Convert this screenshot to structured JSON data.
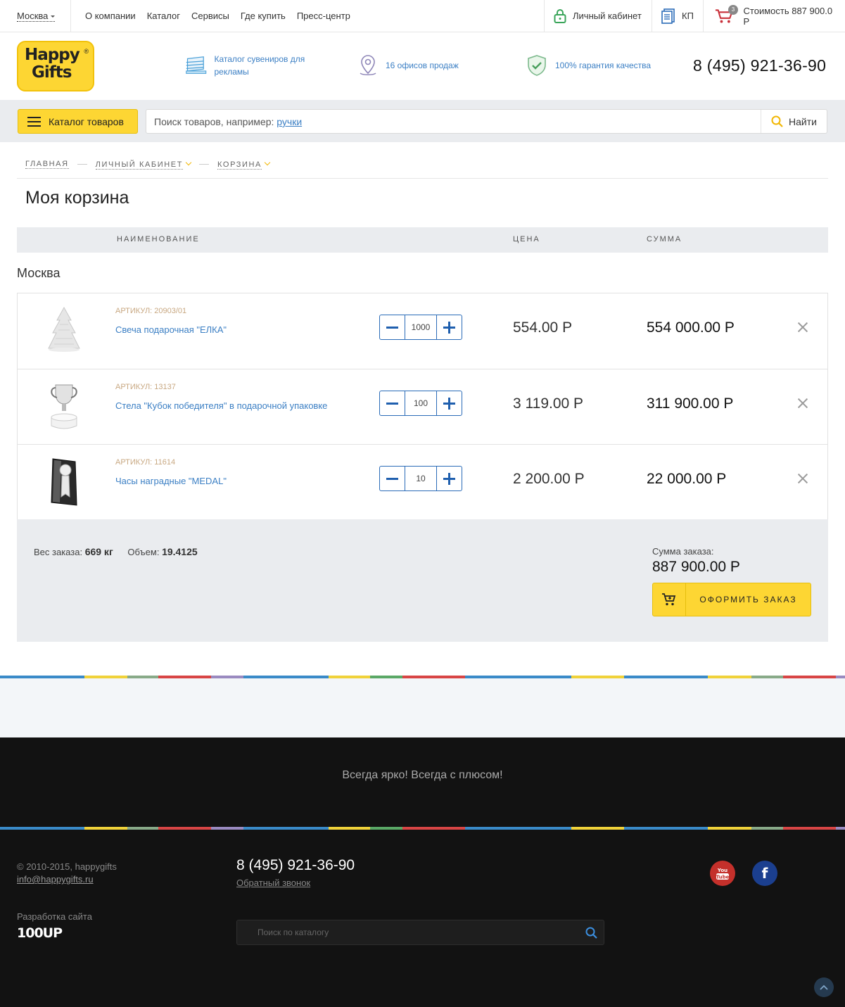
{
  "topbar": {
    "city": "Москва",
    "nav": [
      "О компании",
      "Каталог",
      "Сервисы",
      "Где купить",
      "Пресс-центр"
    ],
    "account": "Личный кабинет",
    "kp": "КП",
    "cart_count": "3",
    "cart_cost": "Стоимость 887 900.0 Р"
  },
  "header": {
    "logo_line1": "Happy",
    "logo_line2": "Gifts",
    "logo_reg": "®",
    "features": [
      {
        "text": "Каталог сувениров для рекламы",
        "icon": "catalog-book-icon"
      },
      {
        "text": "16 офисов продаж",
        "icon": "location-pin-icon"
      },
      {
        "text": "100% гарантия качества",
        "icon": "shield-check-icon"
      }
    ],
    "phone": "8 (495) 921-36-90"
  },
  "search": {
    "catalog_button": "Каталог товаров",
    "placeholder_prefix": "Поиск товаров, например:",
    "placeholder_example": "ручки",
    "button": "Найти"
  },
  "breadcrumbs": [
    "ГЛАВНАЯ",
    "ЛИЧНЫЙ КАБИНЕТ",
    "КОРЗИНА"
  ],
  "page_title": "Моя корзина",
  "table_head": {
    "name": "НАИМЕНОВАНИЕ",
    "price": "ЦЕНА",
    "sum": "СУММА"
  },
  "group": "Москва",
  "items": [
    {
      "article": "АРТИКУЛ: 20903/01",
      "name": "Свеча подарочная \"ЕЛКА\"",
      "qty": "1000",
      "price": "554.00 Р",
      "sum": "554 000.00 Р",
      "image": "candle-tree-image"
    },
    {
      "article": "АРТИКУЛ: 13137",
      "name": "Стела \"Кубок победителя\" в подарочной упаковке",
      "qty": "100",
      "price": "3 119.00 Р",
      "sum": "311 900.00 Р",
      "image": "cup-trophy-image"
    },
    {
      "article": "АРТИКУЛ: 11614",
      "name": "Часы наградные \"MEDAL\"",
      "qty": "10",
      "price": "2 200.00 Р",
      "sum": "22 000.00 Р",
      "image": "medal-clock-image"
    }
  ],
  "summary": {
    "weight_label": "Вес заказа:",
    "weight_value": "669 кг",
    "volume_label": "Объем:",
    "volume_value": "19.4125",
    "total_label": "Сумма заказа:",
    "total_value": "887 900.00 Р",
    "order_button": "ОФОРМИТЬ ЗАКАЗ"
  },
  "footer": {
    "slogan": "Всегда ярко! Всегда с плюсом!",
    "copyright": "© 2010-2015, happygifts",
    "email": "info@happygifts.ru",
    "dev_label": "Разработка сайта",
    "dev_logo": "100UP",
    "phone": "8 (495) 921-36-90",
    "callback": "Обратный звонок",
    "search_placeholder": "Поиск по каталогу"
  },
  "colors": {
    "accent": "#fdd633",
    "link": "#3b7fc4",
    "qty_border": "#2b6cb8"
  }
}
